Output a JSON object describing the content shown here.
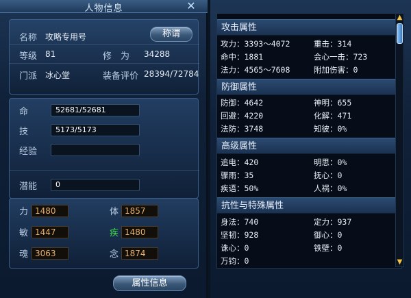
{
  "window_title": "人物信息",
  "close_icon": "✕",
  "basic": {
    "name_label": "名称",
    "name_value": "攻略专用号",
    "title_button": "称谓",
    "level_label": "等级",
    "level_value": "81",
    "cultivation_label": "修　为",
    "cultivation_value": "34288",
    "faction_label": "门派",
    "faction_value": "冰心堂",
    "equip_label": "装备评价",
    "equip_value": "28394/72784"
  },
  "vitals": {
    "hp_label": "命",
    "hp_value": "52681/52681",
    "skill_label": "技",
    "skill_value": "5173/5173",
    "exp_label": "经验",
    "exp_value": ""
  },
  "potential": {
    "label": "潜能",
    "value": "0"
  },
  "attributes": [
    {
      "label": "力",
      "value": "1480"
    },
    {
      "label": "体",
      "value": "1857"
    },
    {
      "label": "敏",
      "value": "1447"
    },
    {
      "label": "疾",
      "value": "1480"
    },
    {
      "label": "魂",
      "value": "3063"
    },
    {
      "label": "念",
      "value": "1874"
    }
  ],
  "attr_info_button": "属性信息",
  "sections": [
    {
      "title": "攻击属性",
      "rows": [
        [
          "攻力：3393～4072",
          "重击：314"
        ],
        [
          "命中：1881",
          "会心一击：723"
        ],
        [
          "法力：4565～7608",
          "附加伤害：0"
        ]
      ]
    },
    {
      "title": "防御属性",
      "rows": [
        [
          "防御：4642",
          "神明：655"
        ],
        [
          "回避：4220",
          "化解：471"
        ],
        [
          "法防：3748",
          "知彼：0%"
        ]
      ]
    },
    {
      "title": "高级属性",
      "rows": [
        [
          "追电：420",
          "明思：0%"
        ],
        [
          "骤雨：35",
          "抚心：0"
        ],
        [
          "疾语：50%",
          "人祸：0%"
        ]
      ]
    },
    {
      "title": "抗性与特殊属性",
      "rows": [
        [
          "身法：740",
          "定力：937"
        ],
        [
          "坚韧：928",
          "御心：0"
        ],
        [
          "诛心：0",
          "铁壁：0"
        ],
        [
          "万钧：0",
          ""
        ]
      ]
    }
  ],
  "colors": {
    "accent_green": "#3fd94a",
    "attr_text": "#e9b06a",
    "scroll_arrow": "#f5c542"
  },
  "scroll_up_icon": "▲",
  "scroll_down_icon": "▼"
}
